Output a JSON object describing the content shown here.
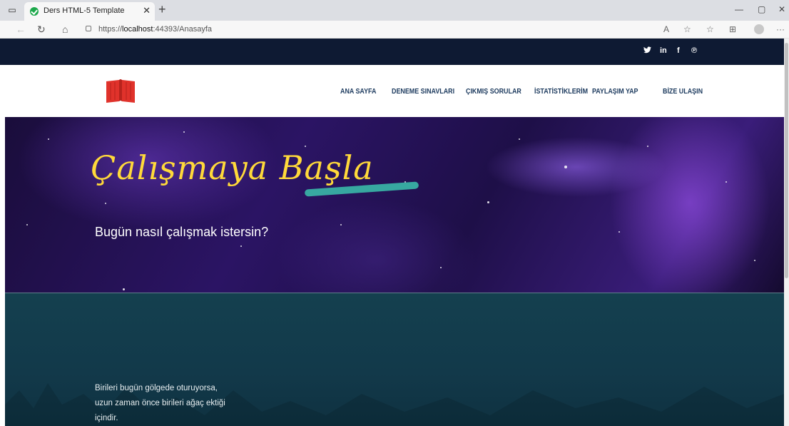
{
  "browser": {
    "tab_title": "Ders HTML-5 Template",
    "url_prefix": "https://",
    "url_host": "localhost",
    "url_path": ":44393/Anasayfa"
  },
  "topbar": {
    "social": [
      "twitter",
      "in",
      "f",
      "pinterest"
    ]
  },
  "nav": {
    "items": [
      {
        "label": "ANA SAYFA"
      },
      {
        "label": "DENEME SINAVLARI"
      },
      {
        "label": "ÇIKMIŞ SORULAR"
      },
      {
        "label": "İSTATİSTİKLERİM"
      },
      {
        "label": "PAYLAŞIM YAP"
      },
      {
        "label": "BİZE ULAŞIN"
      }
    ],
    "logo_color": "#e0322b"
  },
  "hero": {
    "title": "Çalışmaya Başla",
    "subtitle": "Bugün nasıl çalışmak istersin?",
    "title_color": "#ffd93a"
  },
  "quote": {
    "lines": [
      "Birileri bugün gölgede oturuyorsa,",
      "uzun zaman önce birileri ağaç ektiği",
      "içindir."
    ]
  }
}
